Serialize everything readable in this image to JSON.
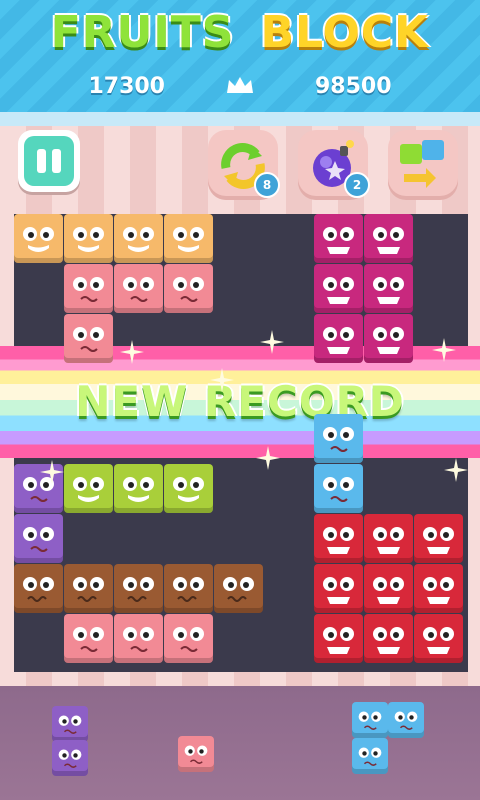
{
  "header": {
    "title_word1": "FRUITS",
    "title_word2": "BLOCK",
    "current_score": "17300",
    "best_score": "98500"
  },
  "powerups": [
    {
      "name": "refresh",
      "count": "8"
    },
    {
      "name": "bomb",
      "count": "2"
    },
    {
      "name": "swap",
      "count": ""
    }
  ],
  "banner": {
    "text": "NEW RECORD"
  },
  "colors": {
    "orange": "#f6b96a",
    "pink": "#f28a95",
    "magenta": "#c8287e",
    "purple": "#8e5fc6",
    "green": "#a9cf3a",
    "blue": "#5ab9ec",
    "brown": "#9a5a32",
    "red": "#d8283a"
  }
}
